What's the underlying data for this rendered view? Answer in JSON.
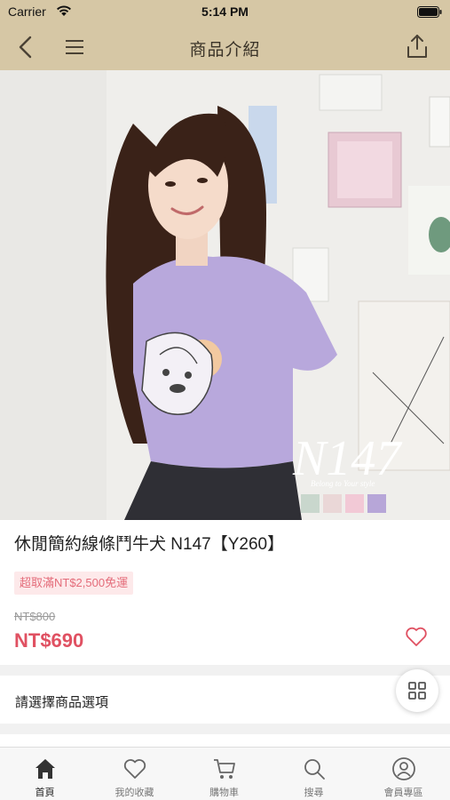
{
  "status_bar": {
    "carrier": "Carrier",
    "time": "5:14 PM"
  },
  "nav": {
    "title": "商品介紹"
  },
  "product": {
    "title": "休閒簡約線條鬥牛犬 N147【Y260】",
    "promo_badge": "超取滿NT$2,500免運",
    "price_original": "NT$800",
    "price_current": "NT$690",
    "image_alt": "Model wearing lavender T-shirt with bulldog line-art print, N147",
    "image_overlay_text": "N147",
    "image_overlay_tagline": "Belong to Your style",
    "color_swatches": [
      "#c9d7cd",
      "#ead7d7",
      "#f2c9d6",
      "#b7a6d8"
    ]
  },
  "options": {
    "label": "請選擇商品選項"
  },
  "tabs": [
    {
      "label": "首頁",
      "icon": "home-icon",
      "active": true
    },
    {
      "label": "我的收藏",
      "icon": "heart-icon",
      "active": false
    },
    {
      "label": "購物車",
      "icon": "cart-icon",
      "active": false
    },
    {
      "label": "搜尋",
      "icon": "search-icon",
      "active": false
    },
    {
      "label": "會員專區",
      "icon": "user-icon",
      "active": false
    }
  ],
  "colors": {
    "nav_background": "#d6c7a5",
    "price_accent": "#e05162",
    "promo_background": "#fde9ea",
    "promo_text": "#e46c7a"
  }
}
